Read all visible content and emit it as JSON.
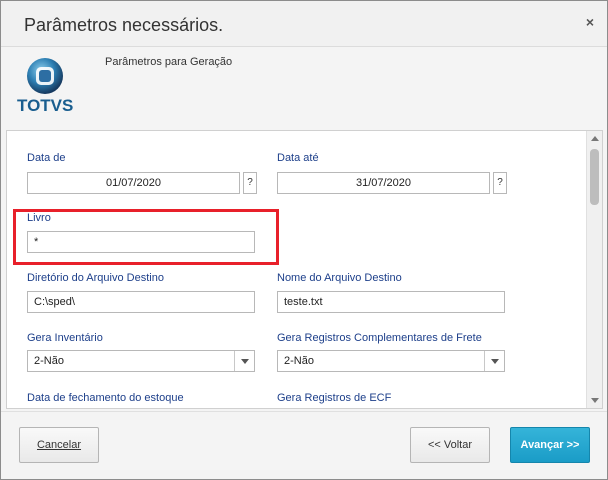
{
  "dialog": {
    "title": "Parâmetros necessários.",
    "close_glyph": "×"
  },
  "header": {
    "logo_text": "TOTVS",
    "subtitle": "Parâmetros para Geração"
  },
  "form": {
    "data_de": {
      "label": "Data de",
      "value": "01/07/2020",
      "help": "?"
    },
    "data_ate": {
      "label": "Data até",
      "value": "31/07/2020",
      "help": "?"
    },
    "livro": {
      "label": "Livro",
      "value": "*"
    },
    "diretorio": {
      "label": "Diretório do Arquivo Destino",
      "value": "C:\\sped\\"
    },
    "nome_arquivo": {
      "label": "Nome do Arquivo Destino",
      "value": "teste.txt"
    },
    "gera_inventario": {
      "label": "Gera Inventário",
      "value": "2-Não"
    },
    "gera_registros_frete": {
      "label": "Gera Registros Complementares de Frete",
      "value": "2-Não"
    },
    "data_fechamento": {
      "label": "Data de fechamento do estoque"
    },
    "gera_registros_ecf": {
      "label": "Gera Registros de ECF"
    }
  },
  "footer": {
    "cancel_label": "Cancelar",
    "back_label": "<< Voltar",
    "next_label": "Avançar >>"
  },
  "colors": {
    "label_blue": "#1d3f8a",
    "highlight_red": "#e8202a",
    "primary_button": "#1a9cc7",
    "logo_blue": "#1a5e8f"
  }
}
